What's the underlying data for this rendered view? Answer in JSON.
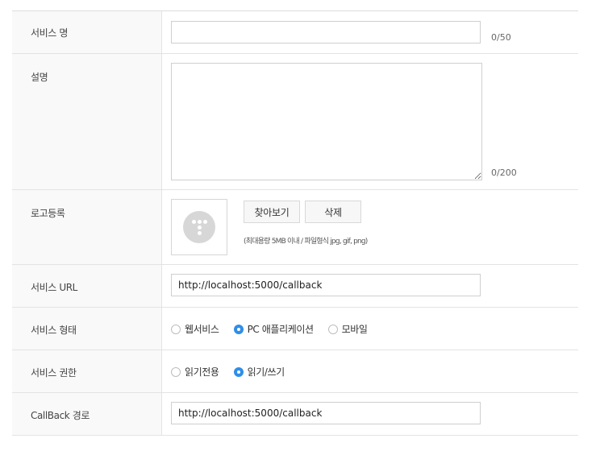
{
  "service_name": {
    "label": "서비스 명",
    "value": "",
    "counter": "0/50"
  },
  "description": {
    "label": "설명",
    "value": "",
    "counter": "0/200"
  },
  "logo": {
    "label": "로고등록",
    "browse_label": "찾아보기",
    "delete_label": "삭제",
    "hint": "(최대용량 5MB 이내 / 파일형식 jpg, gif, png)",
    "placeholder_icon": "logo-placeholder-icon"
  },
  "service_url": {
    "label": "서비스 URL",
    "value": "http://localhost:5000/callback"
  },
  "service_type": {
    "label": "서비스 형태",
    "options": [
      {
        "label": "웹서비스",
        "selected": false
      },
      {
        "label": "PC 애플리케이션",
        "selected": true
      },
      {
        "label": "모바일",
        "selected": false
      }
    ]
  },
  "service_permission": {
    "label": "서비스 권한",
    "options": [
      {
        "label": "읽기전용",
        "selected": false
      },
      {
        "label": "읽기/쓰기",
        "selected": true
      }
    ]
  },
  "callback_path": {
    "label": "CallBack 경로",
    "value": "http://localhost:5000/callback"
  },
  "colors": {
    "accent": "#2f8ee8",
    "label_bg": "#f9f9f9",
    "border": "#e3e3e3"
  }
}
